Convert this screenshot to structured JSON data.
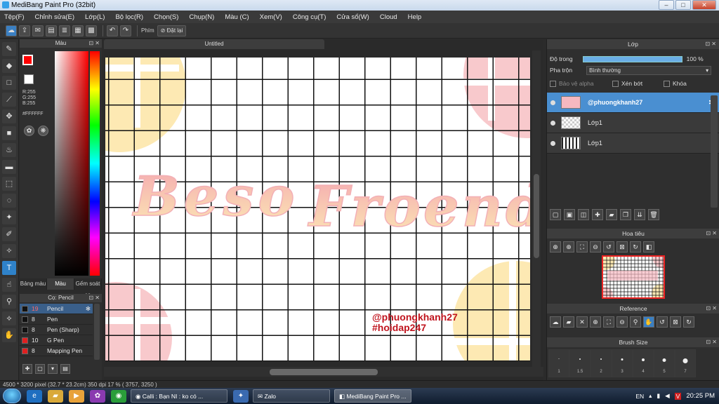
{
  "window": {
    "title": "MediBang Paint Pro (32bit)",
    "min": "–",
    "max": "□",
    "close": "✕"
  },
  "menu": [
    "Tệp(F)",
    "Chỉnh sửa(E)",
    "Lớp(L)",
    "Bộ lọc(R)",
    "Chọn(S)",
    "Chụp(N)",
    "Màu (C)",
    "Xem(V)",
    "Công cụ(T)",
    "Cửa sổ(W)",
    "Cloud",
    "Help"
  ],
  "toolbar": {
    "shortcut_label": "Phím",
    "reset_label": "Đặt lại"
  },
  "color_panel": {
    "title": "Màu",
    "r": "R:255",
    "g": "G:255",
    "b": "B:255",
    "hex": "#FFFFFF",
    "fg_color": "#ff0000"
  },
  "color_tabs": [
    "Bảng màu",
    "Màu",
    "Gếm soát cọ"
  ],
  "brush_panel": {
    "title": "Cọ: Pencil",
    "items": [
      {
        "size": "19",
        "name": "Pencil",
        "color": "#111111"
      },
      {
        "size": "8",
        "name": "Pen",
        "color": "#111111"
      },
      {
        "size": "8",
        "name": "Pen (Sharp)",
        "color": "#111111"
      },
      {
        "size": "10",
        "name": "G Pen",
        "color": "#e02020"
      },
      {
        "size": "8",
        "name": "Mapping Pen",
        "color": "#e02020"
      }
    ]
  },
  "document": {
    "tab": "Untitled",
    "art_text_1": "Beso",
    "art_text_2": "Froend",
    "watermark_1": "@phuongkhanh27",
    "watermark_2": "#hoidap247"
  },
  "layer_panel": {
    "title": "Lớp",
    "opacity_label": "Độ trong",
    "opacity_value": "100 %",
    "opacity": 1.0,
    "blend_label": "Pha trộn",
    "blend_value": "Bình thường",
    "protect_alpha": "Bảo vệ alpha",
    "clipping": "Xén bớt",
    "lock": "Khóa",
    "layers": [
      {
        "name": "@phuongkhanh27",
        "selected": true
      },
      {
        "name": "Lớp1",
        "selected": false
      },
      {
        "name": "Lớp1",
        "selected": false
      }
    ]
  },
  "navigator": {
    "title": "Hoa tiêu"
  },
  "reference": {
    "title": "Reference"
  },
  "brush_size": {
    "title": "Brush Size",
    "sizes": [
      "1",
      "1.5",
      "2",
      "3",
      "4",
      "5",
      "7"
    ]
  },
  "status": {
    "text": "4500 * 3200 pixel  (32.7 * 23.2cm)  350 dpi  17 %  ( 3757, 3250 )"
  },
  "taskbar": {
    "task1": "Calli : Bạn NI : ko có ...",
    "task2": "Zalo",
    "task3": "MediBang Paint Pro ...",
    "lang": "EN",
    "time": "20:25 PM"
  }
}
